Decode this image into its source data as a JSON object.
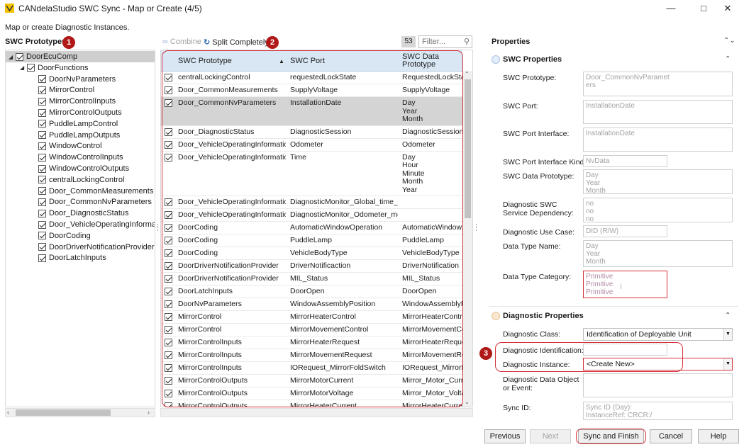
{
  "window": {
    "title": "CANdelaStudio SWC Sync - Map or Create (4/5)",
    "minimize_icon": "minimize-icon",
    "maximize_icon": "maximize-icon",
    "close_icon": "close-icon"
  },
  "subtitle": "Map or create Diagnostic Instances.",
  "badges": [
    "1",
    "2",
    "3"
  ],
  "left": {
    "header": "SWC Prototypes",
    "tree": [
      {
        "label": "DoorEcuComp",
        "level": 0,
        "expanded": true,
        "selected": true
      },
      {
        "label": "DoorFunctions",
        "level": 1,
        "expanded": true
      },
      {
        "label": "DoorNvParameters",
        "level": 2
      },
      {
        "label": "MirrorControl",
        "level": 2
      },
      {
        "label": "MirrorControlInputs",
        "level": 2
      },
      {
        "label": "MirrorControlOutputs",
        "level": 2
      },
      {
        "label": "PuddleLampControl",
        "level": 2
      },
      {
        "label": "PuddleLampOutputs",
        "level": 2
      },
      {
        "label": "WindowControl",
        "level": 2
      },
      {
        "label": "WindowControlInputs",
        "level": 2
      },
      {
        "label": "WindowControlOutputs",
        "level": 2
      },
      {
        "label": "centralLockingControl",
        "level": 2
      },
      {
        "label": "Door_CommonMeasurements",
        "level": 2
      },
      {
        "label": "Door_CommonNvParameters",
        "level": 2
      },
      {
        "label": "Door_DiagnosticStatus",
        "level": 2
      },
      {
        "label": "Door_VehicleOperatingInforma",
        "level": 2
      },
      {
        "label": "DoorCoding",
        "level": 2
      },
      {
        "label": "DoorDriverNotificationProvider",
        "level": 2
      },
      {
        "label": "DoorLatchInputs",
        "level": 2
      }
    ]
  },
  "middle": {
    "combine_label": "Combine",
    "split_label": "Split Completely",
    "count": "53",
    "filter_placeholder": "Filter...",
    "columns": [
      "SWC Prototype",
      "SWC Port",
      "SWC Data Prototype"
    ],
    "rows": [
      {
        "proto": "centralLockingControl",
        "port": "requestedLockState",
        "data": "RequestedLockState",
        "lines": 1
      },
      {
        "proto": "Door_CommonMeasurements",
        "port": "SupplyVoltage",
        "data": "SupplyVoltage",
        "lines": 1
      },
      {
        "proto": "Door_CommonNvParameters",
        "port": "InstallationDate",
        "data": "Day\nYear\nMonth",
        "lines": 3,
        "selected": true
      },
      {
        "proto": "Door_DiagnosticStatus",
        "port": "DiagnosticSession",
        "data": "DiagnosticSession",
        "lines": 1
      },
      {
        "proto": "Door_VehicleOperatingInformation",
        "port": "Odometer",
        "data": "Odometer",
        "lines": 1
      },
      {
        "proto": "Door_VehicleOperatingInformation",
        "port": "Time",
        "data": "Day\nHour\nMinute\nMonth\nYear",
        "lines": 5
      },
      {
        "proto": "Door_VehicleOperatingInformation",
        "port": "DiagnosticMonitor_Global_time_m...",
        "data": "",
        "lines": 1
      },
      {
        "proto": "Door_VehicleOperatingInformation",
        "port": "DiagnosticMonitor_Odometer_me...",
        "data": "",
        "lines": 1
      },
      {
        "proto": "DoorCoding",
        "port": "AutomaticWindowOperation",
        "data": "AutomaticWindow...",
        "lines": 1
      },
      {
        "proto": "DoorCoding",
        "port": "PuddleLamp",
        "data": "PuddleLamp",
        "lines": 1
      },
      {
        "proto": "DoorCoding",
        "port": "VehicleBodyType",
        "data": "VehicleBodyType",
        "lines": 1
      },
      {
        "proto": "DoorDriverNotificationProvider",
        "port": "DriverNotificaction",
        "data": "DriverNotification",
        "lines": 1
      },
      {
        "proto": "DoorDriverNotificationProvider",
        "port": "MIL_Status",
        "data": "MIL_Status",
        "lines": 1
      },
      {
        "proto": "DoorLatchInputs",
        "port": "DoorOpen",
        "data": "DoorOpen",
        "lines": 1
      },
      {
        "proto": "DoorNvParameters",
        "port": "WindowAssemblyPosition",
        "data": "WindowAssemblyP...",
        "lines": 1
      },
      {
        "proto": "MirrorControl",
        "port": "MirrorHeaterControl",
        "data": "MirrorHeaterControl",
        "lines": 1
      },
      {
        "proto": "MirrorControl",
        "port": "MirrorMovementControl",
        "data": "MirrorMovementCo...",
        "lines": 1
      },
      {
        "proto": "MirrorControlInputs",
        "port": "MirrorHeaterRequest",
        "data": "MirrorHeaterReques...",
        "lines": 1
      },
      {
        "proto": "MirrorControlInputs",
        "port": "MirrorMovementRequest",
        "data": "MirrorMovementRe...",
        "lines": 1
      },
      {
        "proto": "MirrorControlInputs",
        "port": "IORequest_MirrorFoldSwitch",
        "data": "IORequest_MirrorF...",
        "lines": 1
      },
      {
        "proto": "MirrorControlOutputs",
        "port": "MirrorMotorCurrent",
        "data": "Mirror_Motor_Curr...",
        "lines": 1
      },
      {
        "proto": "MirrorControlOutputs",
        "port": "MirrorMotorVoltage",
        "data": "Mirror_Motor_Volta...",
        "lines": 1
      },
      {
        "proto": "MirrorControlOutputs",
        "port": "MirrorHeaterCurrent",
        "data": "MirrorHeaterCurrent",
        "lines": 1
      }
    ]
  },
  "properties": {
    "header": "Properties",
    "swc_section": "SWC Properties",
    "swc_prototype_label": "SWC Prototype:",
    "swc_prototype_value": "Door_CommonNvParamet\ners",
    "swc_port_label": "SWC Port:",
    "swc_port_value": "InstallationDate",
    "swc_port_interface_label": "SWC Port Interface:",
    "swc_port_interface_value": "InstallationDate",
    "swc_port_interface_kind_label": "SWC Port Interface Kind:",
    "swc_port_interface_kind_value": "NvData",
    "swc_data_prototype_label": "SWC Data Prototype:",
    "swc_data_prototype_value": "Day\nYear\nMonth",
    "diag_swc_dep_label": "Diagnostic SWC\nService Dependency:",
    "diag_swc_dep_value": "no\nno\nno",
    "diag_use_case_label": "Diagnostic Use Case:",
    "diag_use_case_value": "DID (R/W)",
    "data_type_name_label": "Data Type Name:",
    "data_type_name_value": "Day\nYear\nMonth",
    "data_type_category_label": "Data Type Category:",
    "data_type_category_value": "Primitive\nPrimitive\nPrimitive",
    "diag_section": "Diagnostic Properties",
    "diag_class_label": "Diagnostic Class:",
    "diag_class_value": "Identification of Deployable Unit",
    "diag_ident_label": "Diagnostic Identification:",
    "diag_ident_value": "",
    "diag_instance_label": "Diagnostic Instance:",
    "diag_instance_value": "<Create New>",
    "diag_data_object_label": "Diagnostic Data Object\nor Event:",
    "diag_data_object_value": "",
    "sync_id_label": "Sync ID:",
    "sync_id_value": "Sync ID (Day):\nInstanceRef: CRCR:/"
  },
  "buttons": {
    "previous": "Previous",
    "next": "Next",
    "sync_finish": "Sync and Finish",
    "cancel": "Cancel",
    "help": "Help"
  },
  "colors": {
    "accent_red": "#d6303a",
    "badge_red": "#b01818",
    "grid_header": "#d9e7f4",
    "link_blue": "#2563b0"
  }
}
